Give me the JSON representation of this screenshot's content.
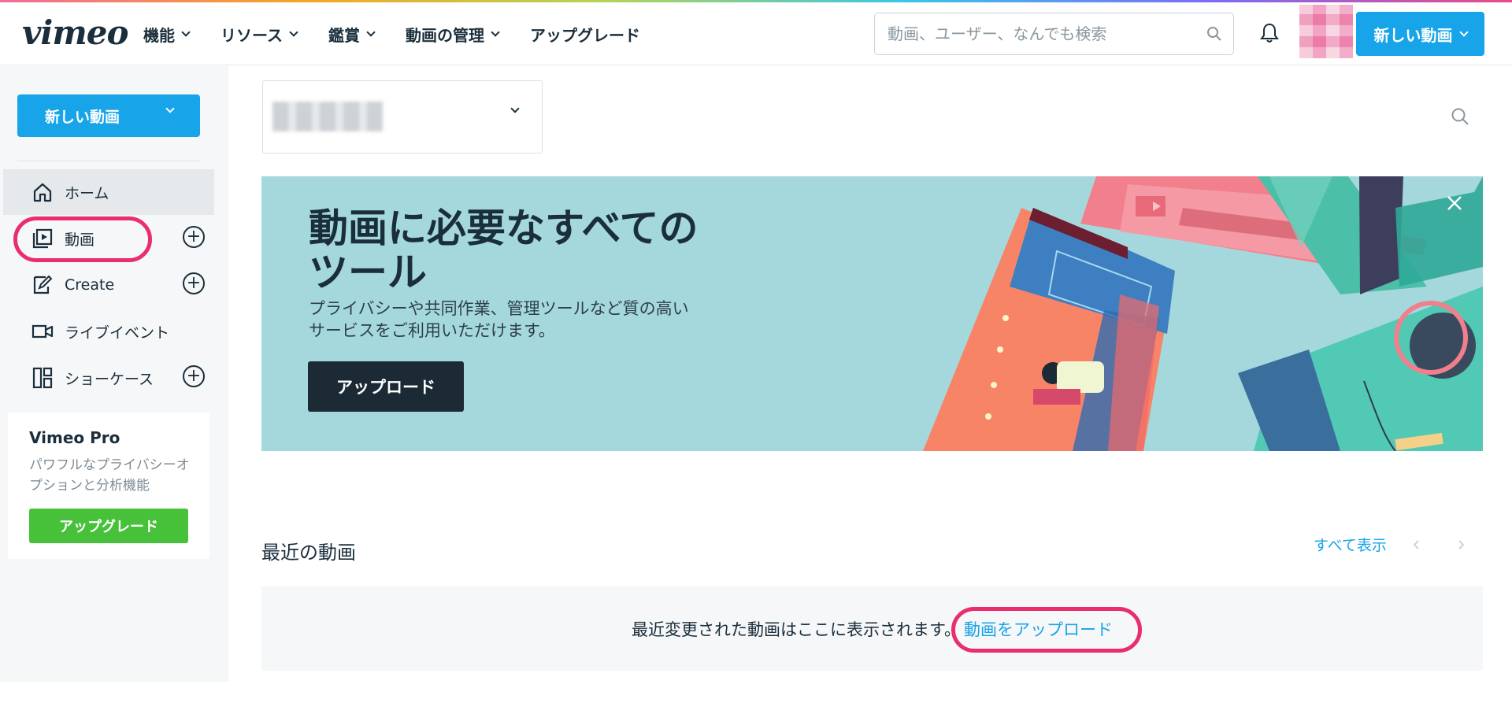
{
  "header": {
    "logo": "vimeo",
    "nav": [
      {
        "label": "機能",
        "dropdown": true
      },
      {
        "label": "リソース",
        "dropdown": true
      },
      {
        "label": "鑑賞",
        "dropdown": true
      },
      {
        "label": "動画の管理",
        "dropdown": true
      },
      {
        "label": "アップグレード",
        "dropdown": false
      }
    ],
    "search_placeholder": "動画、ユーザー、なんでも検索",
    "new_video_label": "新しい動画"
  },
  "sidebar": {
    "new_video_label": "新しい動画",
    "items": [
      {
        "label": "ホーム",
        "icon": "home-icon",
        "active": true,
        "plus": false
      },
      {
        "label": "動画",
        "icon": "video-icon",
        "active": false,
        "plus": true
      },
      {
        "label": "Create",
        "icon": "create-icon",
        "active": false,
        "plus": true
      },
      {
        "label": "ライブイベント",
        "icon": "camera-icon",
        "active": false,
        "plus": false
      },
      {
        "label": "ショーケース",
        "icon": "showcase-icon",
        "active": false,
        "plus": true
      }
    ],
    "pro": {
      "title": "Vimeo Pro",
      "description": "パワフルなプライバシーオプションと分析機能",
      "button": "アップグレード"
    }
  },
  "banner": {
    "title": "動画に必要なすべてのツール",
    "description": "プライバシーや共同作業、管理ツールなど質の高いサービスをご利用いただけます。",
    "upload_label": "アップロード"
  },
  "recent": {
    "title": "最近の動画",
    "see_all": "すべて表示",
    "empty_text": "最近変更された動画はここに表示されます。",
    "upload_link": "動画をアップロード"
  },
  "colors": {
    "accent": "#17a4e8",
    "upgrade": "#48c13a",
    "banner_bg": "#a5d8dc",
    "highlight": "#ea2d6e"
  }
}
